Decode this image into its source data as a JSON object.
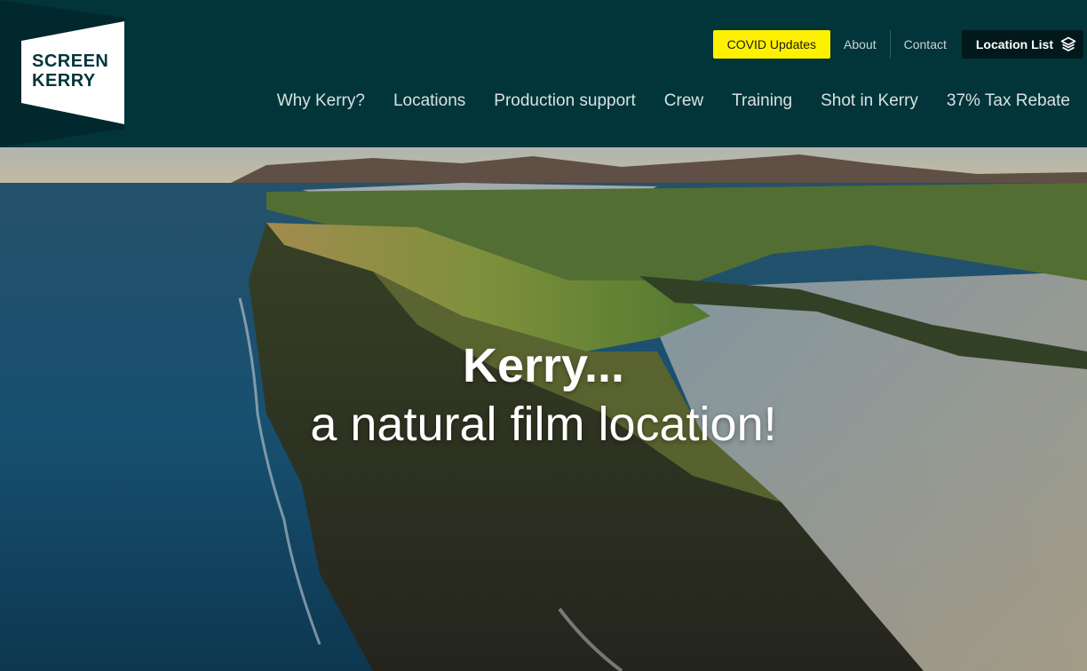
{
  "brand": {
    "line1": "SCREEN",
    "line2": "KERRY"
  },
  "top_nav": {
    "covid": "COVID Updates",
    "about": "About",
    "contact": "Contact",
    "location_list": "Location List",
    "location_list_icon": "layers-icon"
  },
  "main_nav": [
    "Why Kerry?",
    "Locations",
    "Production support",
    "Crew",
    "Training",
    "Shot in Kerry",
    "37% Tax Rebate"
  ],
  "hero": {
    "title": "Kerry...",
    "subtitle": "a natural film location!"
  },
  "colors": {
    "header_bg": "#02353a",
    "covid_yellow": "#fff200",
    "location_btn_bg": "#01191b"
  }
}
